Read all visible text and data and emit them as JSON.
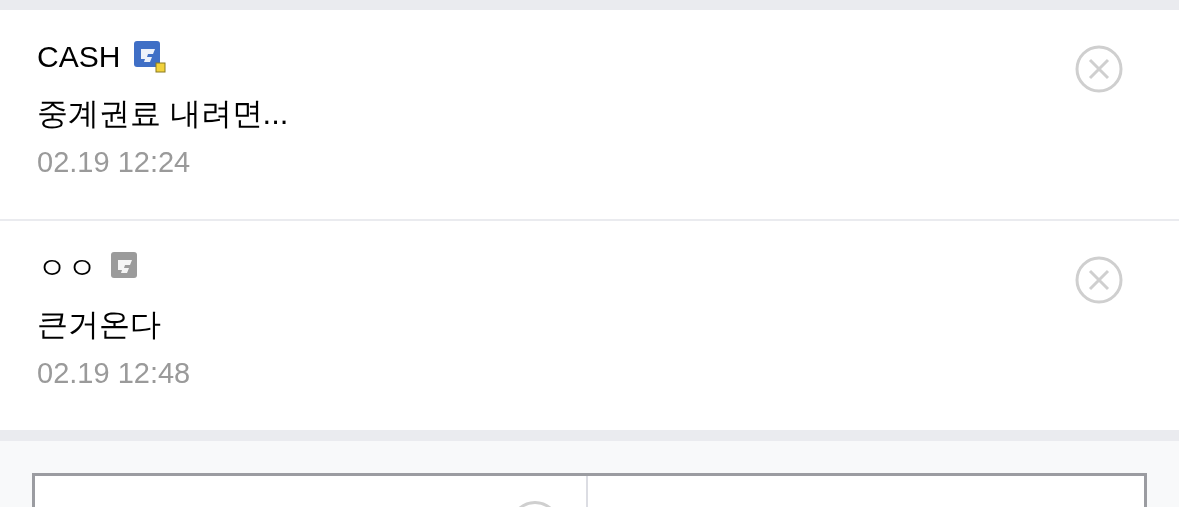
{
  "comments": [
    {
      "author": "CASH",
      "color": "#3f6fc6",
      "badge_dot": true,
      "message": "중계권료 내려면...",
      "time": "02.19 12:24"
    },
    {
      "author": "ㅇㅇ",
      "color": "#9b9b9b",
      "badge_dot": false,
      "message": "큰거온다",
      "time": "02.19 12:48"
    }
  ]
}
